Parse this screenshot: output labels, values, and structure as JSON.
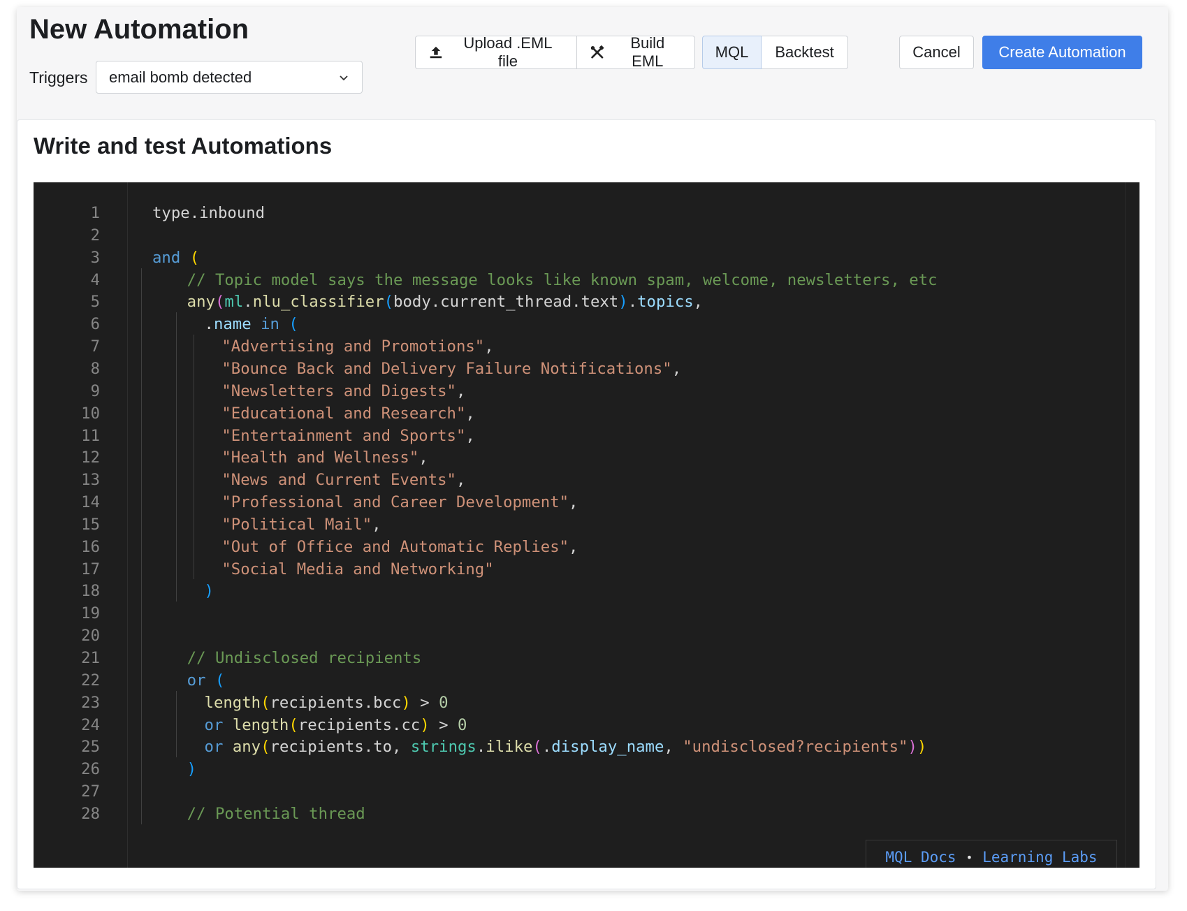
{
  "header": {
    "title": "New Automation",
    "triggers_label": "Triggers",
    "trigger_value": "email bomb detected",
    "upload_label": "Upload .EML file",
    "build_label": "Build EML",
    "mql_label": "MQL",
    "backtest_label": "Backtest",
    "cancel_label": "Cancel",
    "create_label": "Create Automation"
  },
  "panel": {
    "title": "Write and test Automations"
  },
  "editor": {
    "lines": [
      {
        "n": "1",
        "indent": 0,
        "tokens": [
          [
            "type.inbound",
            "op"
          ]
        ]
      },
      {
        "n": "2",
        "indent": 0,
        "tokens": []
      },
      {
        "n": "3",
        "indent": 0,
        "tokens": [
          [
            "and",
            "kw"
          ],
          [
            " ",
            "op"
          ],
          [
            "(",
            "b1"
          ]
        ]
      },
      {
        "n": "4",
        "indent": 4,
        "tokens": [
          [
            "// Topic model says the message looks like known spam, welcome, newsletters, etc",
            "cm"
          ]
        ]
      },
      {
        "n": "5",
        "indent": 4,
        "tokens": [
          [
            "any",
            "fn"
          ],
          [
            "(",
            "b2"
          ],
          [
            "ml",
            "ns"
          ],
          [
            ".",
            "op"
          ],
          [
            "nlu_classifier",
            "fn"
          ],
          [
            "(",
            "b3"
          ],
          [
            "body.current_thread.text",
            "op"
          ],
          [
            ")",
            "b3"
          ],
          [
            ".",
            "op"
          ],
          [
            "topics",
            "pr"
          ],
          [
            ",",
            "op"
          ]
        ]
      },
      {
        "n": "6",
        "indent": 6,
        "tokens": [
          [
            ".",
            "op"
          ],
          [
            "name",
            "pr"
          ],
          [
            " ",
            "op"
          ],
          [
            "in",
            "kw"
          ],
          [
            " ",
            "op"
          ],
          [
            "(",
            "b3"
          ]
        ]
      },
      {
        "n": "7",
        "indent": 8,
        "tokens": [
          [
            "\"Advertising and Promotions\"",
            "st"
          ],
          [
            ",",
            "op"
          ]
        ]
      },
      {
        "n": "8",
        "indent": 8,
        "tokens": [
          [
            "\"Bounce Back and Delivery Failure Notifications\"",
            "st"
          ],
          [
            ",",
            "op"
          ]
        ]
      },
      {
        "n": "9",
        "indent": 8,
        "tokens": [
          [
            "\"Newsletters and Digests\"",
            "st"
          ],
          [
            ",",
            "op"
          ]
        ]
      },
      {
        "n": "10",
        "indent": 8,
        "tokens": [
          [
            "\"Educational and Research\"",
            "st"
          ],
          [
            ",",
            "op"
          ]
        ]
      },
      {
        "n": "11",
        "indent": 8,
        "tokens": [
          [
            "\"Entertainment and Sports\"",
            "st"
          ],
          [
            ",",
            "op"
          ]
        ]
      },
      {
        "n": "12",
        "indent": 8,
        "tokens": [
          [
            "\"Health and Wellness\"",
            "st"
          ],
          [
            ",",
            "op"
          ]
        ]
      },
      {
        "n": "13",
        "indent": 8,
        "tokens": [
          [
            "\"News and Current Events\"",
            "st"
          ],
          [
            ",",
            "op"
          ]
        ]
      },
      {
        "n": "14",
        "indent": 8,
        "tokens": [
          [
            "\"Professional and Career Development\"",
            "st"
          ],
          [
            ",",
            "op"
          ]
        ]
      },
      {
        "n": "15",
        "indent": 8,
        "tokens": [
          [
            "\"Political Mail\"",
            "st"
          ],
          [
            ",",
            "op"
          ]
        ]
      },
      {
        "n": "16",
        "indent": 8,
        "tokens": [
          [
            "\"Out of Office and Automatic Replies\"",
            "st"
          ],
          [
            ",",
            "op"
          ]
        ]
      },
      {
        "n": "17",
        "indent": 8,
        "tokens": [
          [
            "\"Social Media and Networking\"",
            "st"
          ]
        ]
      },
      {
        "n": "18",
        "indent": 6,
        "tokens": [
          [
            ")",
            "b3"
          ]
        ]
      },
      {
        "n": "19",
        "indent": 0,
        "tokens": []
      },
      {
        "n": "20",
        "indent": 0,
        "tokens": []
      },
      {
        "n": "21",
        "indent": 4,
        "tokens": [
          [
            "// Undisclosed recipients",
            "cm"
          ]
        ]
      },
      {
        "n": "22",
        "indent": 4,
        "tokens": [
          [
            "or",
            "kw"
          ],
          [
            " ",
            "op"
          ],
          [
            "(",
            "b3"
          ]
        ]
      },
      {
        "n": "23",
        "indent": 6,
        "tokens": [
          [
            "length",
            "fn"
          ],
          [
            "(",
            "b1"
          ],
          [
            "recipients.bcc",
            "op"
          ],
          [
            ")",
            "b1"
          ],
          [
            " > ",
            "op"
          ],
          [
            "0",
            "nu"
          ]
        ]
      },
      {
        "n": "24",
        "indent": 6,
        "tokens": [
          [
            "or",
            "kw"
          ],
          [
            " ",
            "op"
          ],
          [
            "length",
            "fn"
          ],
          [
            "(",
            "b1"
          ],
          [
            "recipients.cc",
            "op"
          ],
          [
            ")",
            "b1"
          ],
          [
            " > ",
            "op"
          ],
          [
            "0",
            "nu"
          ]
        ]
      },
      {
        "n": "25",
        "indent": 6,
        "tokens": [
          [
            "or",
            "kw"
          ],
          [
            " ",
            "op"
          ],
          [
            "any",
            "fn"
          ],
          [
            "(",
            "b1"
          ],
          [
            "recipients.to, ",
            "op"
          ],
          [
            "strings",
            "ns"
          ],
          [
            ".",
            "op"
          ],
          [
            "ilike",
            "fn"
          ],
          [
            "(",
            "b2"
          ],
          [
            ".",
            "op"
          ],
          [
            "display_name",
            "pr"
          ],
          [
            ", ",
            "op"
          ],
          [
            "\"undisclosed?recipients\"",
            "st"
          ],
          [
            ")",
            "b2"
          ],
          [
            ")",
            "b1"
          ]
        ]
      },
      {
        "n": "26",
        "indent": 4,
        "tokens": [
          [
            ")",
            "b3"
          ]
        ]
      },
      {
        "n": "27",
        "indent": 0,
        "tokens": []
      },
      {
        "n": "28",
        "indent": 4,
        "tokens": [
          [
            "// Potential thread",
            "cm"
          ]
        ]
      }
    ],
    "links": {
      "docs": "MQL Docs",
      "separator": "•",
      "labs": "Learning Labs"
    }
  },
  "colors": {
    "accent": "#3f7ee8",
    "editor_bg": "#1e1e1e"
  },
  "icons": {
    "upload": "upload-icon",
    "build": "tools-icon",
    "dropdown": "chevron-down-icon"
  }
}
